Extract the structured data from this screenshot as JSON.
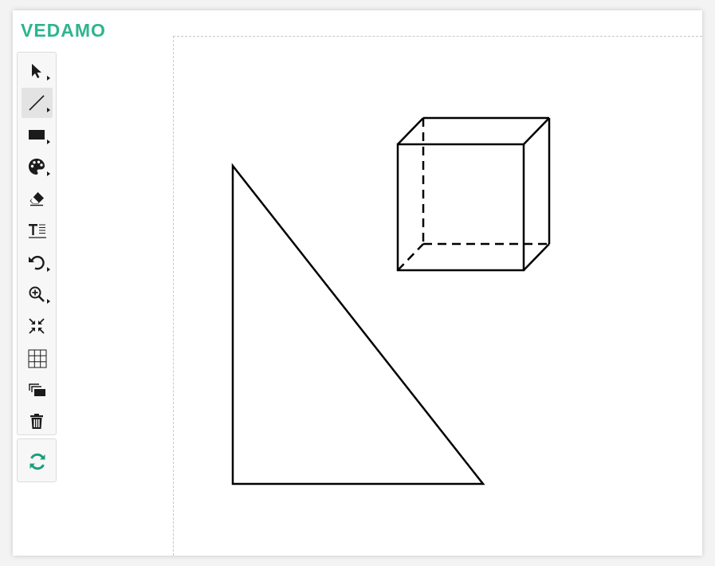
{
  "brand": {
    "logo_text": "VEDAMO",
    "color": "#2fb48e"
  },
  "toolbar": {
    "tools": [
      {
        "icon": "pointer-icon",
        "active": false,
        "has_submenu": true
      },
      {
        "icon": "line-icon",
        "active": true,
        "has_submenu": true
      },
      {
        "icon": "rectangle-icon",
        "active": false,
        "has_submenu": true
      },
      {
        "icon": "palette-icon",
        "active": false,
        "has_submenu": true
      },
      {
        "icon": "eraser-icon",
        "active": false,
        "has_submenu": false
      },
      {
        "icon": "text-icon",
        "active": false,
        "has_submenu": false
      },
      {
        "icon": "undo-icon",
        "active": false,
        "has_submenu": true
      },
      {
        "icon": "zoom-in-icon",
        "active": false,
        "has_submenu": true
      },
      {
        "icon": "collapse-icon",
        "active": false,
        "has_submenu": false
      },
      {
        "icon": "grid-icon",
        "active": false,
        "has_submenu": false
      },
      {
        "icon": "layers-icon",
        "active": false,
        "has_submenu": false
      },
      {
        "icon": "trash-icon",
        "active": false,
        "has_submenu": false
      }
    ],
    "sync": {
      "icon": "sync-icon",
      "color": "#1aa079"
    }
  },
  "canvas": {
    "shapes": [
      "right-triangle",
      "cube"
    ],
    "stroke_color": "#000000"
  }
}
